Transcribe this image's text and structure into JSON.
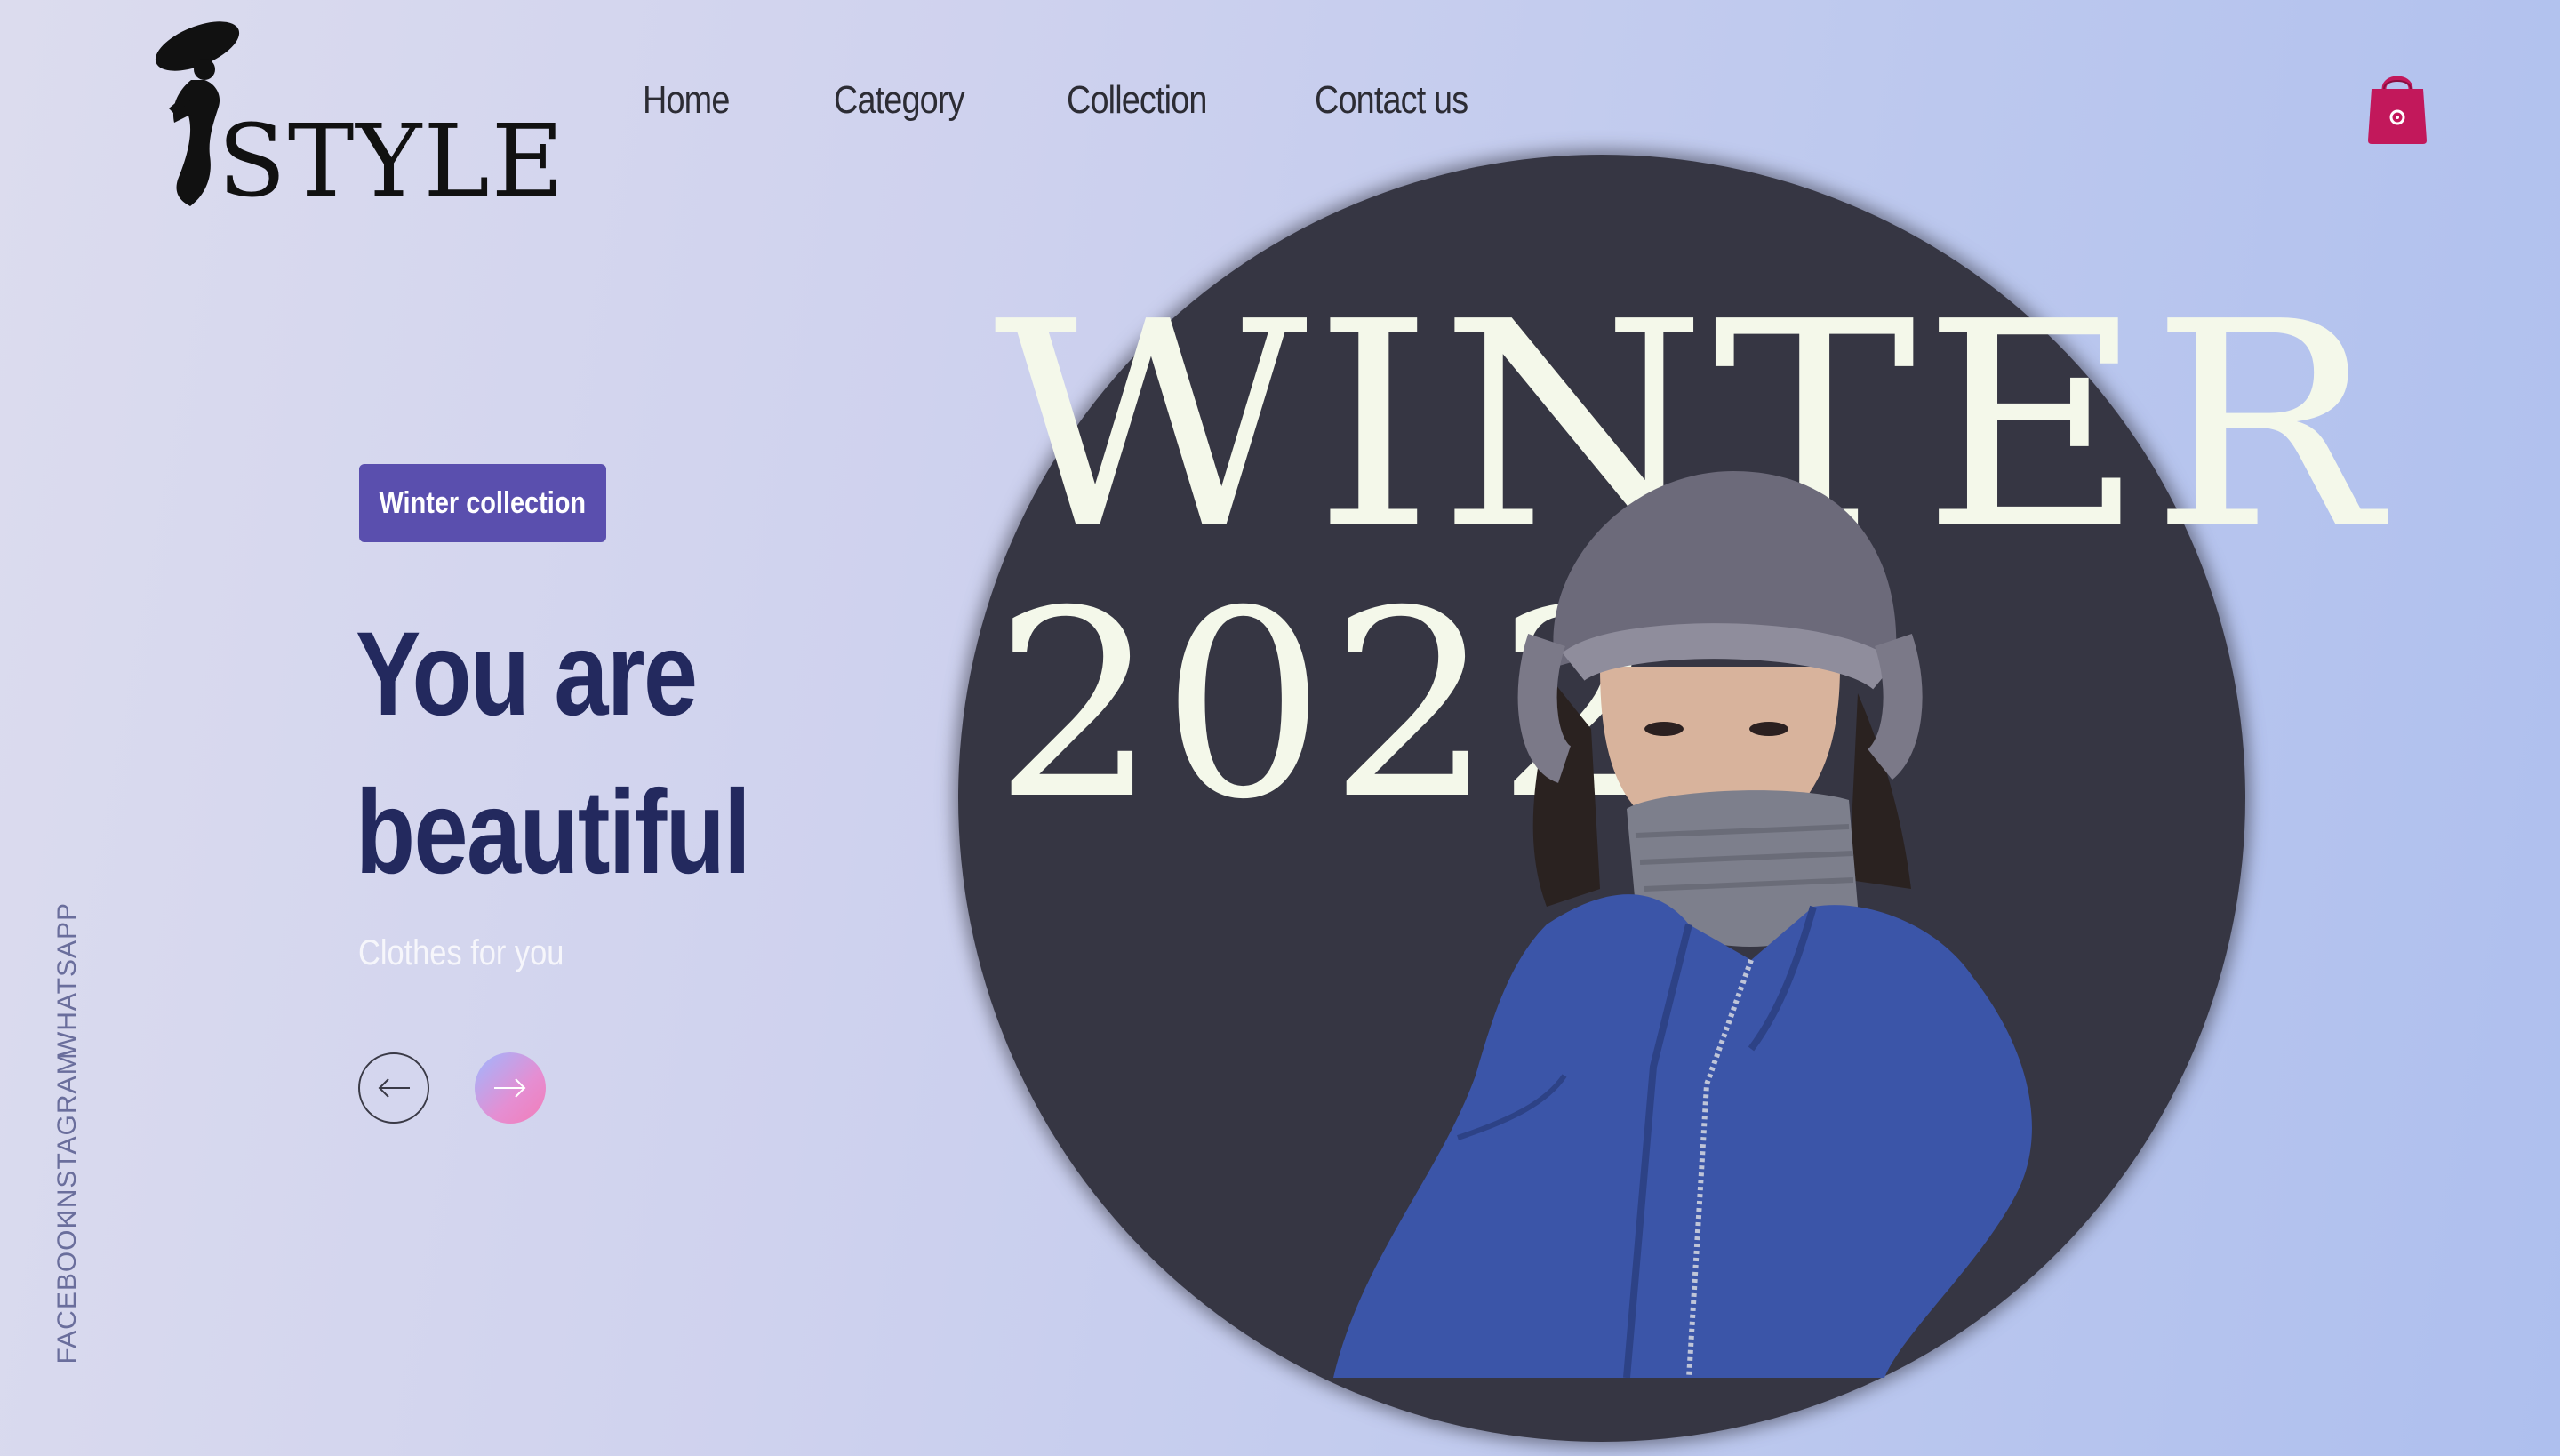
{
  "brand": {
    "logo_text": "STYLE"
  },
  "nav": {
    "items": [
      "Home",
      "Category",
      "Collection",
      "Contact us"
    ]
  },
  "cart": {
    "icon": "shopping-bag-icon",
    "color": "#c2185b"
  },
  "hero": {
    "badge": "Winter collection",
    "headline_line1": "You are",
    "headline_line2": "beautiful",
    "subtitle": "Clothes for you",
    "big_word": "WINTER",
    "big_year": "2022",
    "prev_icon": "arrow-left-icon",
    "next_icon": "arrow-right-icon"
  },
  "social": [
    "WHATSAPP",
    "INSTAGRAM",
    "FACEBOOK"
  ],
  "colors": {
    "accent": "#5a4fae",
    "headline": "#23295e",
    "circle": "#363643",
    "hero_text": "#f4f8ea",
    "coat": "#3b55a8"
  }
}
